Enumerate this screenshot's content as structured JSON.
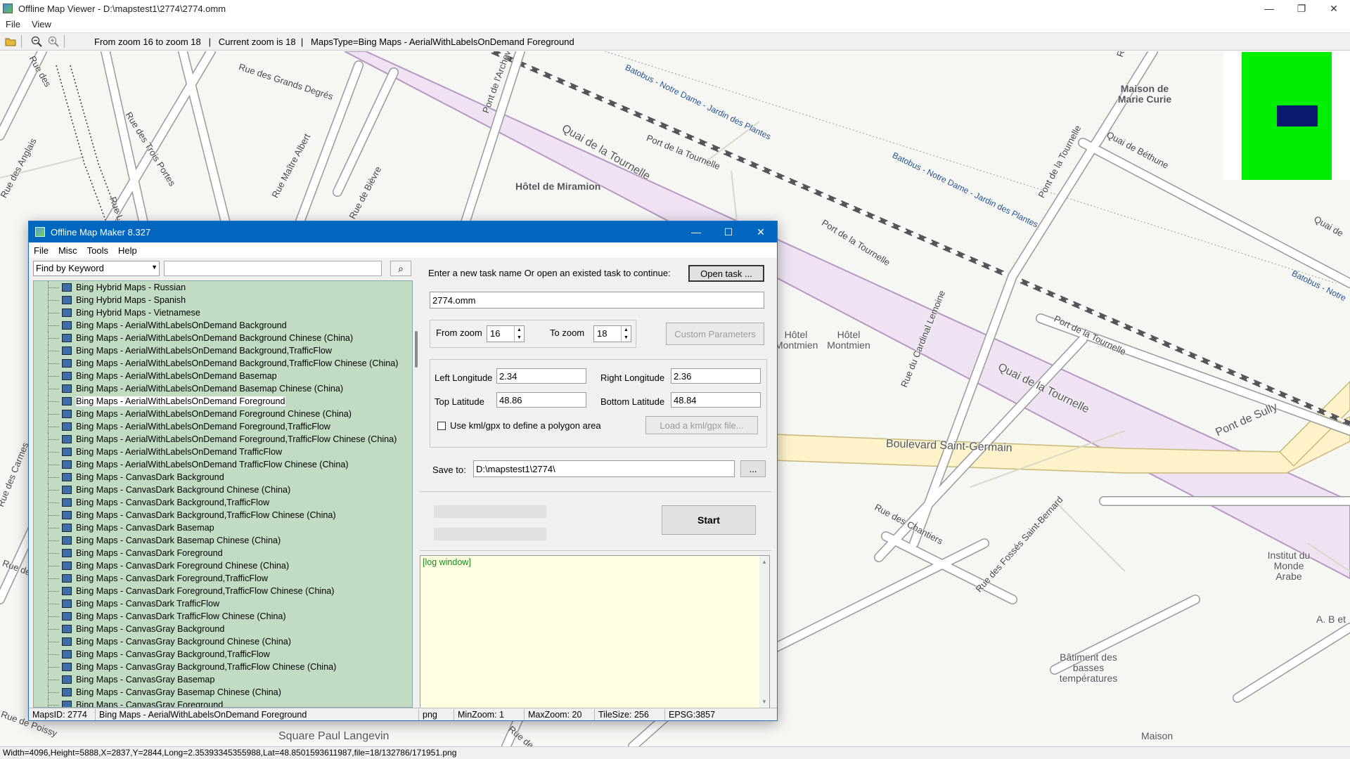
{
  "app": {
    "title": "Offline Map Viewer - D:\\mapstest1\\2774\\2774.omm",
    "menu": [
      "File",
      "View"
    ],
    "window_buttons": [
      "—",
      "❐",
      "✕"
    ]
  },
  "toolbar": {
    "info": "From zoom 16 to zoom 18   |   Current zoom is 18  |   MapsType=Bing Maps - AerialWithLabelsOnDemand Foreground"
  },
  "statusbar": {
    "text": "Width=4096,Height=5888,X=2837,Y=2844,Long=2.35393345355988,Lat=48.8501593611987,file=18/132786/171951.png"
  },
  "map": {
    "street_labels": [
      "Rue des Grands Degrés",
      "Rue des Trois Portes",
      "Rue des Anglais",
      "Rue Lagrange",
      "Rue Maître Albert",
      "Rue de Bièvre",
      "Pont de l'Archevêché",
      "Quai de la Tournelle",
      "Port de la Tournelle",
      "Port de la Tournelle",
      "Port de la Tournelle",
      "Quai de la Tournelle",
      "Quai de Béthune",
      "Pont de la Tournelle",
      "Quai de",
      "Rue du Cardinal Lemoine",
      "Boulevard Saint-Germain",
      "Pont de Sully",
      "Rue des Chantiers",
      "Rue des Fossés Saint-Bernard",
      "Rue des Carmes",
      "Square Paul Langevin",
      "Rue de",
      "Rue de Poissy",
      "Rue de Pontoise"
    ],
    "transit_labels": [
      "Batobus - Notre Dame - Jardin des Plantes",
      "Batobus - Notre Dame - Jardin des Plantes",
      "Batobus - Notre"
    ],
    "poi_labels": [
      "Maison de Marie Curie",
      "Hôtel de Miramion",
      "Hôtel Montmien",
      "Hôtel Montmien",
      "Institut du Monde Arabe",
      "Bâtiment des basses températures",
      "A. B et",
      "Maison",
      "Rue Bu",
      "Rue des"
    ],
    "colors": {
      "background": "#f6f6f3",
      "river_band": "#efe3f3",
      "river_edge": "#b596c4",
      "boulevard": "#fdf2c8",
      "rail": "#555555",
      "minimap_green": "#00ee00",
      "minimap_rect": "#0a1a70"
    }
  },
  "dialog": {
    "title": "Offline Map Maker 8.327",
    "menu": [
      "File",
      "Misc",
      "Tools",
      "Help"
    ],
    "search_mode": "Find by Keyword",
    "search_value": "",
    "map_list": [
      "Bing Hybrid Maps - Russian",
      "Bing Hybrid Maps - Spanish",
      "Bing Hybrid Maps - Vietnamese",
      "Bing Maps - AerialWithLabelsOnDemand Background",
      "Bing Maps - AerialWithLabelsOnDemand Background Chinese (China)",
      "Bing Maps - AerialWithLabelsOnDemand Background,TrafficFlow",
      "Bing Maps - AerialWithLabelsOnDemand Background,TrafficFlow Chinese (China)",
      "Bing Maps - AerialWithLabelsOnDemand Basemap",
      "Bing Maps - AerialWithLabelsOnDemand Basemap Chinese (China)",
      "Bing Maps - AerialWithLabelsOnDemand Foreground",
      "Bing Maps - AerialWithLabelsOnDemand Foreground Chinese (China)",
      "Bing Maps - AerialWithLabelsOnDemand Foreground,TrafficFlow",
      "Bing Maps - AerialWithLabelsOnDemand Foreground,TrafficFlow Chinese (China)",
      "Bing Maps - AerialWithLabelsOnDemand TrafficFlow",
      "Bing Maps - AerialWithLabelsOnDemand TrafficFlow Chinese (China)",
      "Bing Maps - CanvasDark Background",
      "Bing Maps - CanvasDark Background Chinese (China)",
      "Bing Maps - CanvasDark Background,TrafficFlow",
      "Bing Maps - CanvasDark Background,TrafficFlow Chinese (China)",
      "Bing Maps - CanvasDark Basemap",
      "Bing Maps - CanvasDark Basemap Chinese (China)",
      "Bing Maps - CanvasDark Foreground",
      "Bing Maps - CanvasDark Foreground Chinese (China)",
      "Bing Maps - CanvasDark Foreground,TrafficFlow",
      "Bing Maps - CanvasDark Foreground,TrafficFlow Chinese (China)",
      "Bing Maps - CanvasDark TrafficFlow",
      "Bing Maps - CanvasDark TrafficFlow Chinese (China)",
      "Bing Maps - CanvasGray Background",
      "Bing Maps - CanvasGray Background Chinese (China)",
      "Bing Maps - CanvasGray Background,TrafficFlow",
      "Bing Maps - CanvasGray Background,TrafficFlow Chinese (China)",
      "Bing Maps - CanvasGray Basemap",
      "Bing Maps - CanvasGray Basemap Chinese (China)",
      "Bing Maps - CanvasGray Foreground"
    ],
    "selected_index": 9,
    "task_prompt": "Enter a new task name Or open an existed task to continue:",
    "open_task_label": "Open task ...",
    "task_name": "2774.omm",
    "from_zoom_label": "From zoom",
    "from_zoom": "16",
    "to_zoom_label": "To zoom",
    "to_zoom": "18",
    "custom_params_label": "Custom Parameters",
    "left_lon_label": "Left Longitude",
    "left_lon": "2.34",
    "right_lon_label": "Right Longitude",
    "right_lon": "2.36",
    "top_lat_label": "Top Latitude",
    "top_lat": "48.86",
    "bottom_lat_label": "Bottom Latitude",
    "bottom_lat": "48.84",
    "kml_label": "Use kml/gpx to define a polygon area",
    "kml_checked": false,
    "load_kml_label": "Load a kml/gpx file...",
    "save_to_label": "Save to:",
    "save_to": "D:\\mapstest1\\2774\\",
    "browse_label": "...",
    "start_label": "Start",
    "log_text": "[log window]",
    "status": {
      "maps_id": "MapsID: 2774",
      "map_name": "Bing Maps - AerialWithLabelsOnDemand Foreground",
      "format": "png",
      "min_zoom": "MinZoom: 1",
      "max_zoom": "MaxZoom: 20",
      "tile_size": "TileSize: 256",
      "epsg": "EPSG:3857"
    }
  }
}
